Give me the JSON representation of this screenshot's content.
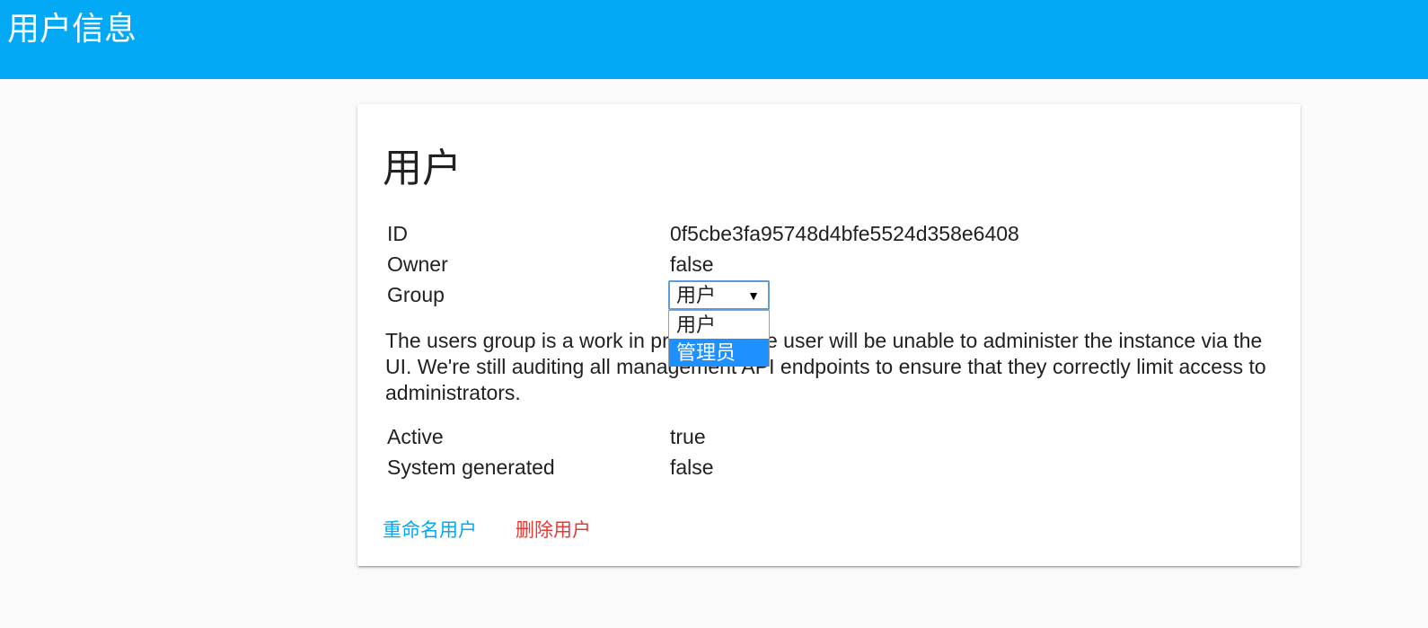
{
  "header": {
    "title": "用户信息",
    "color": "#03a9f4"
  },
  "card": {
    "title": "用户",
    "fields": {
      "id": {
        "label": "ID",
        "value": "0f5cbe3fa95748d4bfe5524d358e6408"
      },
      "owner": {
        "label": "Owner",
        "value": "false"
      },
      "group": {
        "label": "Group",
        "selected": "用户",
        "options": [
          "用户",
          "管理员"
        ],
        "highlighted_option": "管理员"
      },
      "active": {
        "label": "Active",
        "value": "true"
      },
      "system_generated": {
        "label": "System generated",
        "value": "false"
      }
    },
    "note": "The users group is a work in progress. The user will be unable to administer the instance via the UI. We're still auditing all management API endpoints to ensure that they correctly limit access to administrators.",
    "actions": {
      "rename": "重命名用户",
      "delete": "删除用户"
    }
  },
  "colors": {
    "accent": "#03a9f4",
    "danger": "#e53935",
    "select_highlight": "#1e90ff"
  },
  "icons": {
    "select_arrow": "dropdown-arrow-icon",
    "floating_badge": "search-icon"
  }
}
